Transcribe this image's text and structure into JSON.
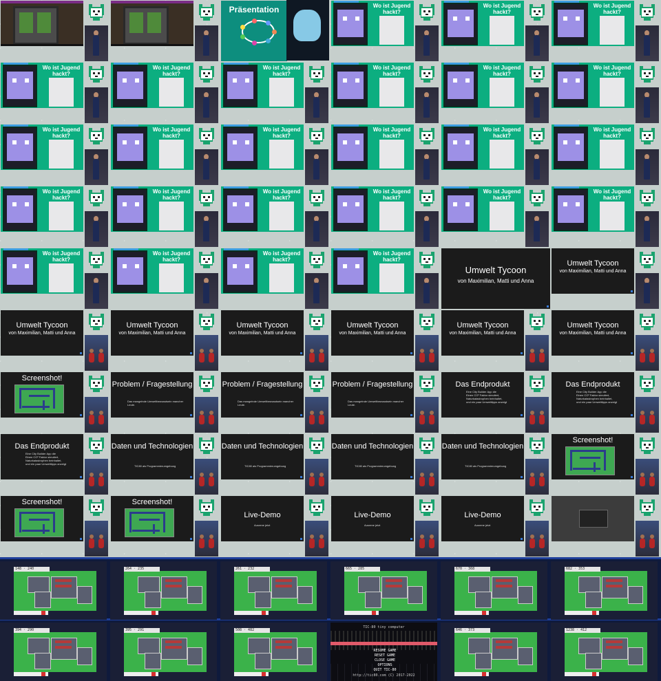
{
  "slides": {
    "praesentation": "Präsentation",
    "wo_ist": "Wo ist Jugend hackt?",
    "umwelt_title": "Umwelt Tycoon",
    "umwelt_sub": "von Maximilian, Matti und Anna",
    "problem_title": "Problem / Fragestellung",
    "problem_body": "Das mangelnde Umweltbewusstsein mancher Leute.",
    "endprodukt_title": "Das Endprodukt",
    "endprodukt_body": [
      "Eine City Builder App die",
      "Einen CO² Faktor simuliert,",
      "Naturkatastrophen beinhaltet,",
      "und ein paar Umwelttipps anzeigt"
    ],
    "daten_title": "Daten und Technologien",
    "daten_body": "TIC80 als Programmierumgebung",
    "screenshot_title": "Screenshot!",
    "live_title": "Live-Demo",
    "live_body": "Ausrene jetzt"
  },
  "strip": {
    "row1_hud": [
      "148 · 240",
      "264 · 235",
      "261 · 232",
      "665 · 285",
      "670 · 368",
      "682 · 353"
    ],
    "row2_hud": [
      "394 · 290",
      "395 · 291",
      "508 · 482",
      "",
      "646 · 373",
      "1238 · 412"
    ],
    "menu_title": "TIC-80 tiny computer",
    "menu_items": [
      "RESUME GAME",
      "RESET GAME",
      "CLOSE GAME",
      "OPTIONS",
      "QUIT TIC-80"
    ],
    "menu_footer": "http://tic80.com (C) 2017-2022"
  },
  "colors": {
    "slide_green": "#0cae80",
    "slide_dark": "#1b1b1b",
    "game_green": "#3bb24a",
    "mascot_green": "#1aa36e"
  }
}
